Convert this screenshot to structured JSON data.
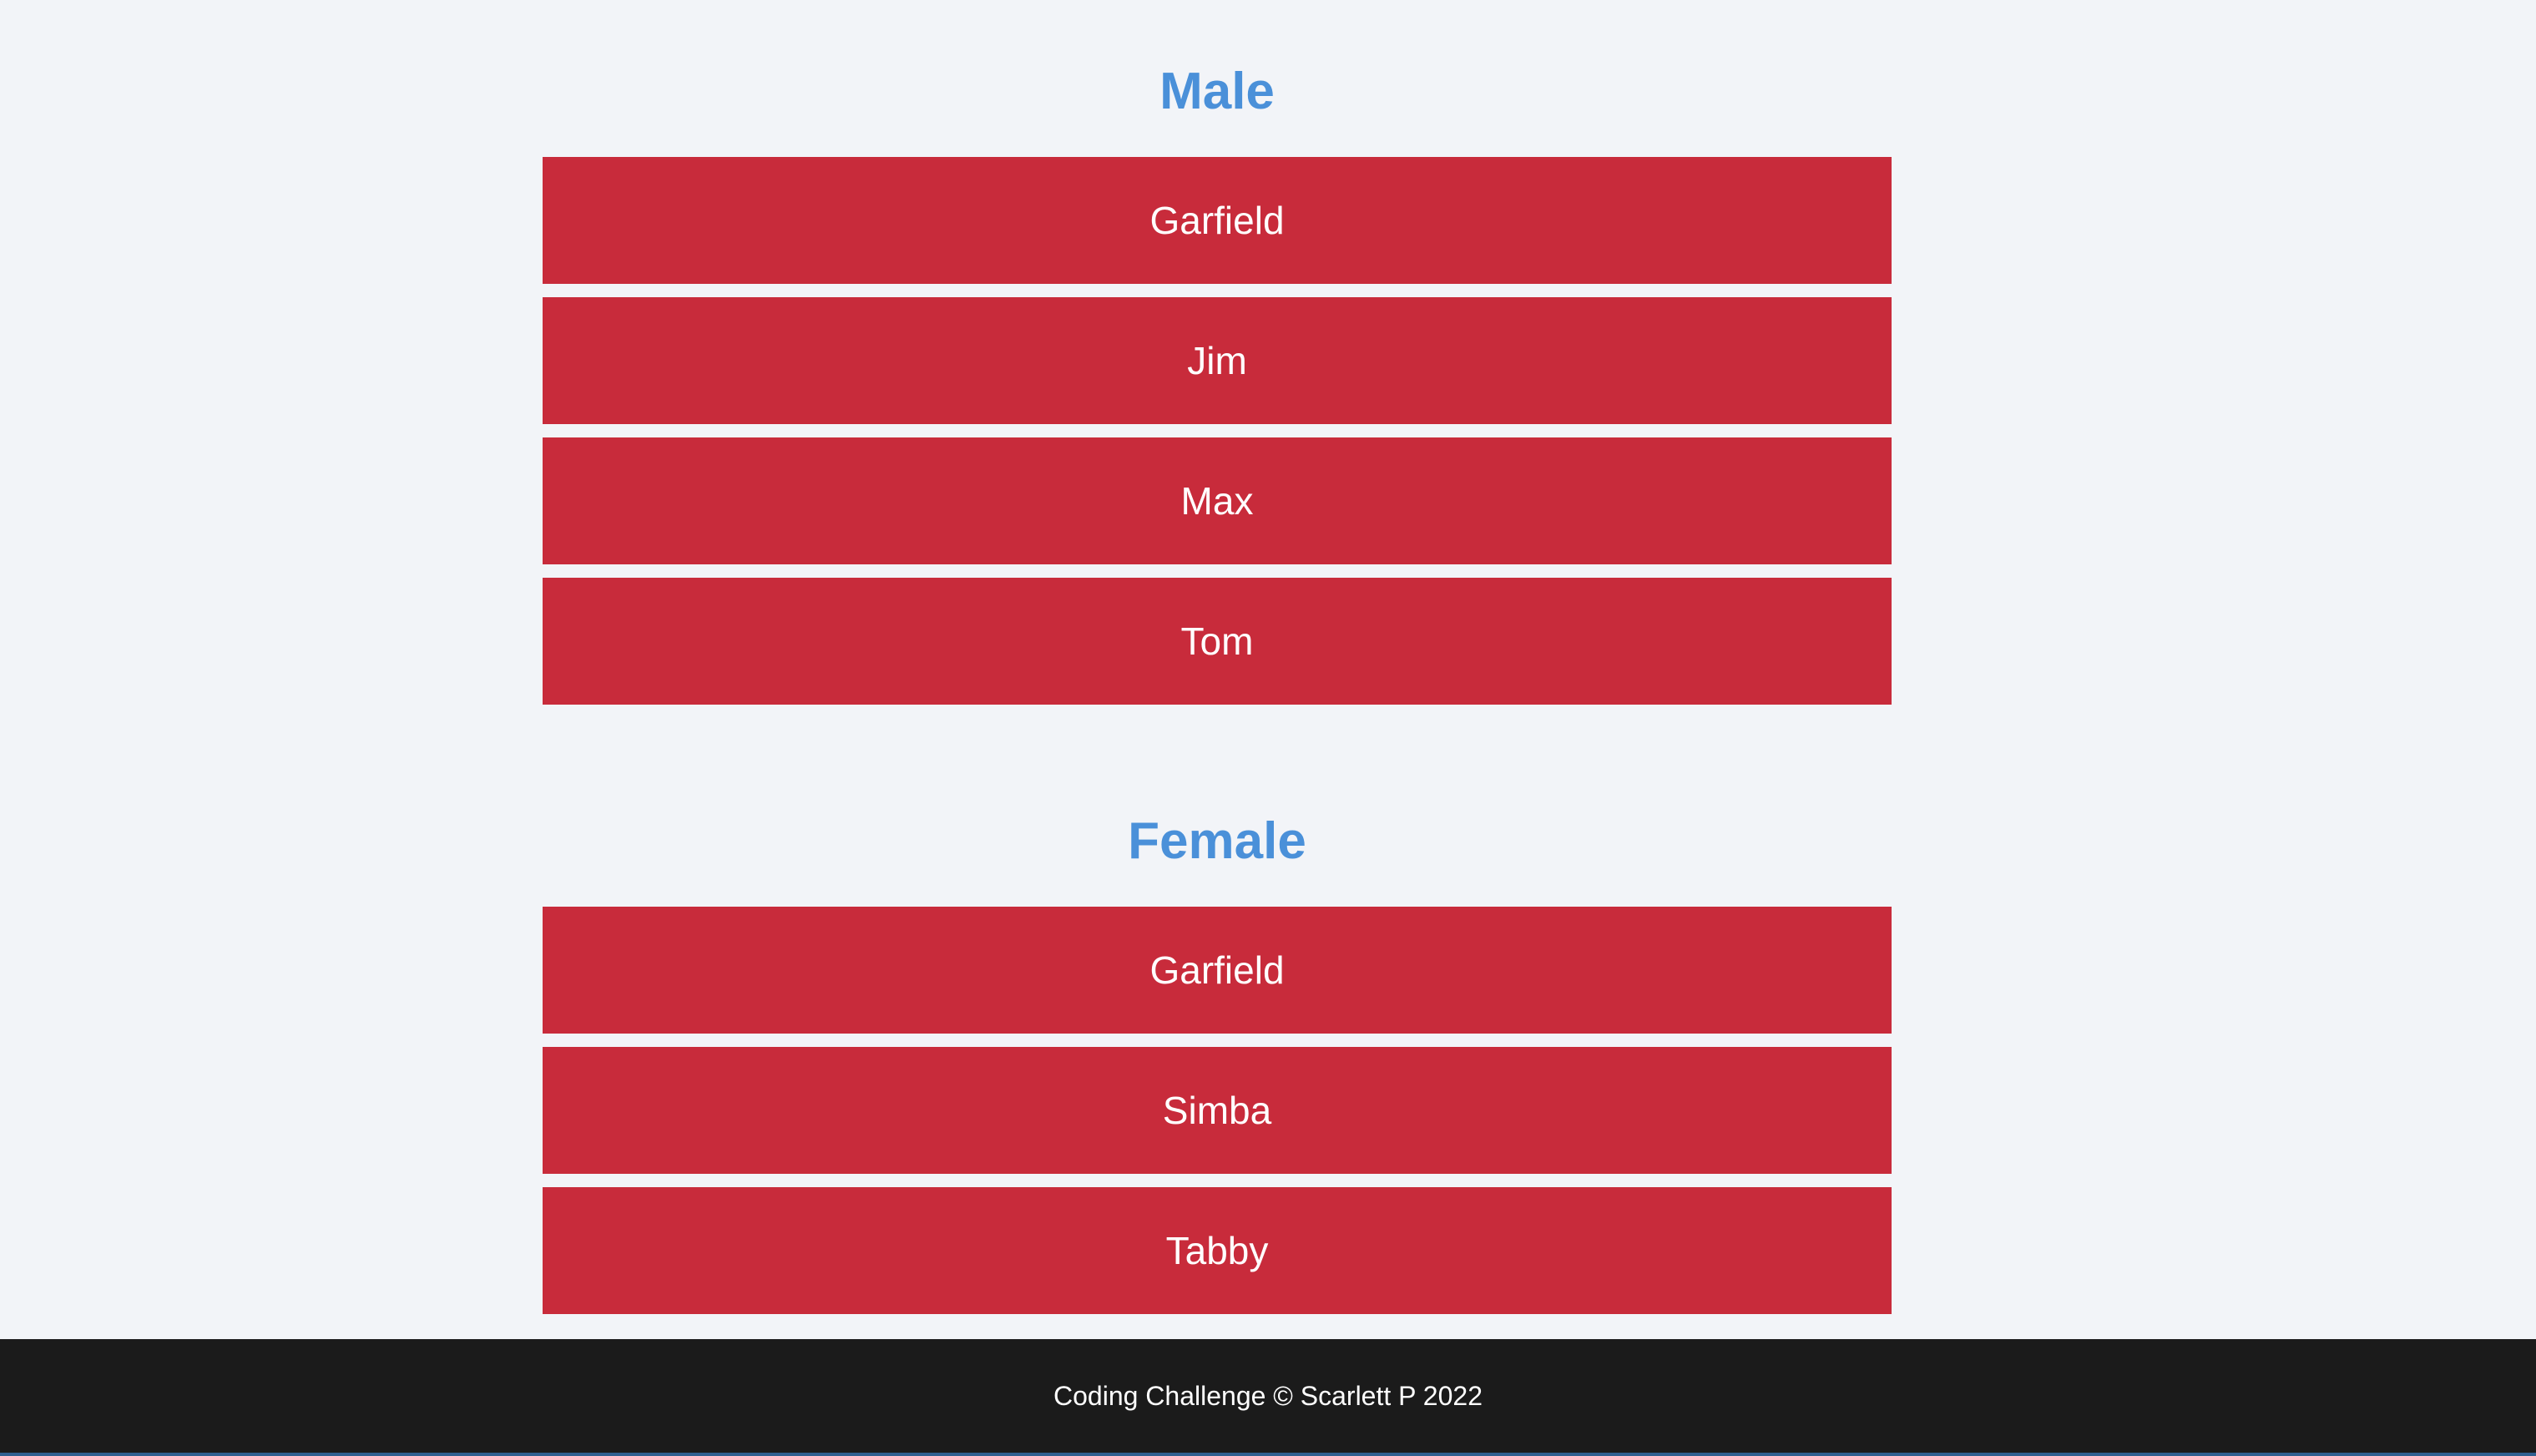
{
  "sections": [
    {
      "title": "Male",
      "items": [
        "Garfield",
        "Jim",
        "Max",
        "Tom"
      ]
    },
    {
      "title": "Female",
      "items": [
        "Garfield",
        "Simba",
        "Tabby"
      ]
    }
  ],
  "footer": {
    "text": "Coding Challenge © Scarlett P 2022"
  },
  "colors": {
    "background": "#f2f4f8",
    "heading": "#4a90d9",
    "item_background": "#c82b3b",
    "item_text": "#ffffff",
    "footer_background": "#1b1b1b",
    "footer_text": "#ffffff"
  }
}
